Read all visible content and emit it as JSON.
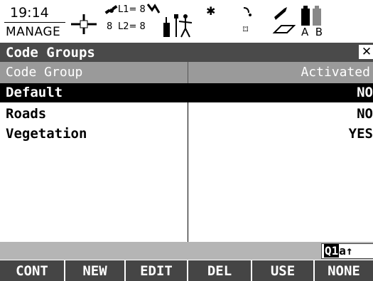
{
  "status": {
    "time": "19:14",
    "mode": "MANAGE",
    "l1": "L1= 8",
    "l2": "L2= 8",
    "sats": "8",
    "letters": "A  B"
  },
  "title": "Code Groups",
  "table": {
    "headers": [
      "Code Group",
      "Activated"
    ],
    "rows": [
      {
        "name": "Default",
        "value": "NO",
        "selected": true
      },
      {
        "name": "Roads",
        "value": "NO",
        "selected": false
      },
      {
        "name": "Vegetation",
        "value": "YES",
        "selected": false
      }
    ]
  },
  "input_mode": {
    "q": "Q1",
    "rest": "a↑"
  },
  "fkeys": [
    "CONT",
    "NEW",
    "EDIT",
    "DEL",
    "USE",
    "NONE"
  ],
  "icons": [
    "crosshair-icon",
    "satellite-icon",
    "antenna-icon",
    "person-icon",
    "bluetooth-icon",
    "radio-icon",
    "pen-icon",
    "battery-icon"
  ]
}
